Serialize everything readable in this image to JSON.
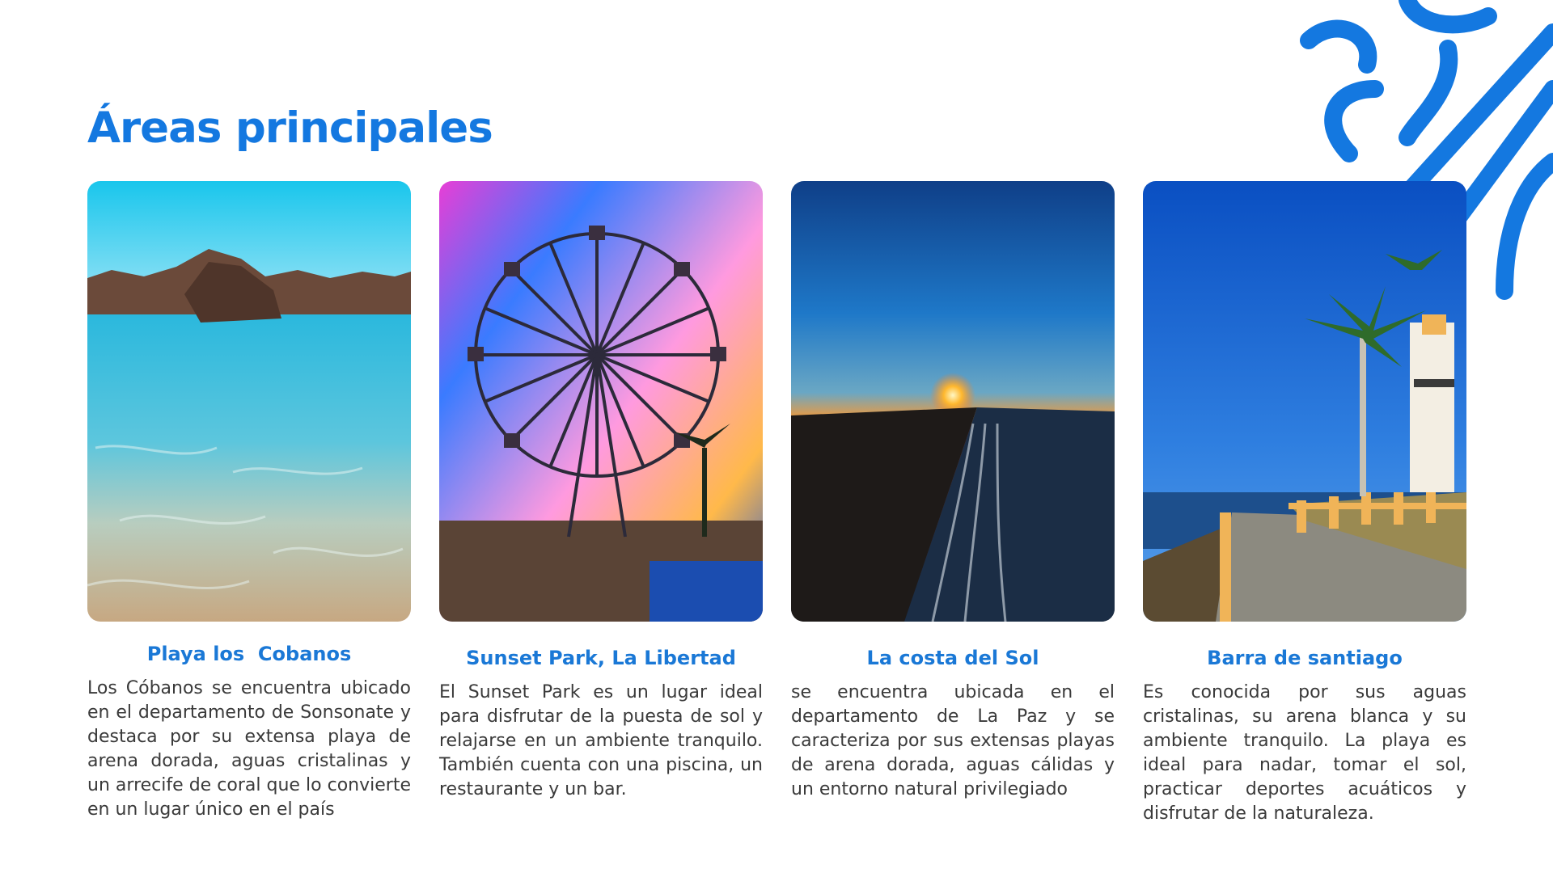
{
  "page": {
    "title": "Áreas principales"
  },
  "colors": {
    "accent": "#1478e0",
    "card_title": "#1a78d6",
    "body_text": "#3a3a3a"
  },
  "cards": [
    {
      "title": "Playa los  Cobanos",
      "text": "Los Cóbanos se encuentra ubicado en el departamento de Sonsonate y destaca por su extensa playa de arena dorada, aguas cristalinas y un arrecife de coral que lo convierte en un lugar único en el país"
    },
    {
      "title": "Sunset Park, La Libertad",
      "text": "El Sunset Park es un lugar ideal para disfrutar de la puesta de sol y relajarse en un ambiente tranquilo. También cuenta con una piscina, un restaurante y un bar."
    },
    {
      "title": "La costa del Sol",
      "text": "se encuentra ubicada en el departamento de La Paz y se caracteriza por sus extensas playas de arena dorada, aguas cálidas y un entorno natural privilegiado"
    },
    {
      "title": "Barra de santiago",
      "text": "Es conocida por sus aguas cristalinas, su arena blanca y su ambiente tranquilo. La playa es ideal para nadar, tomar el sol, practicar deportes acuáticos y disfrutar de la naturaleza."
    }
  ]
}
